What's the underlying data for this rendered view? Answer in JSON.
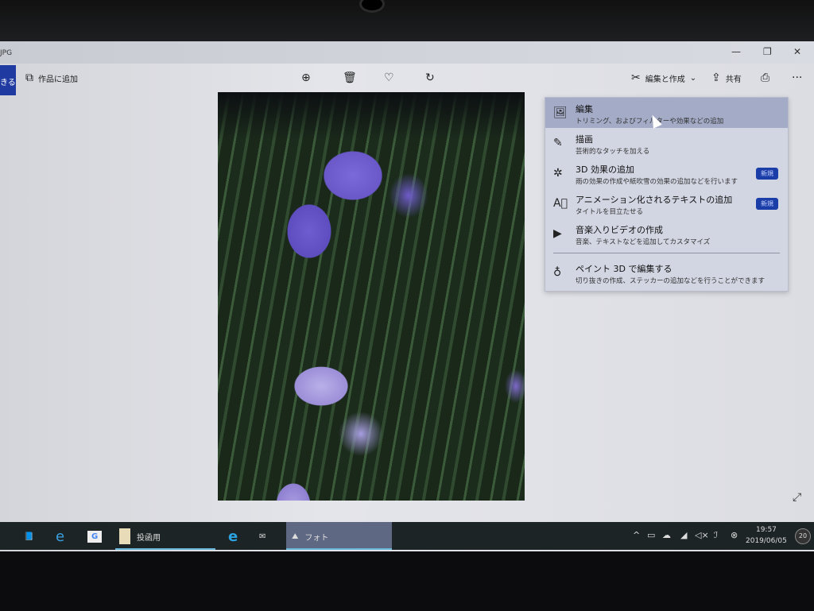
{
  "window": {
    "title": "JPG",
    "minimize": "—",
    "restore": "❐",
    "close": "✕"
  },
  "toolbar": {
    "back_label": "きる",
    "add_to_creation": "作品に追加",
    "edit_create": "編集と作成",
    "share": "共有",
    "more": "···"
  },
  "menu": {
    "items": [
      {
        "title": "編集",
        "subtitle": "トリミング、およびフィルターや効果などの追加",
        "icon": "image-edit-icon",
        "selected": true
      },
      {
        "title": "描画",
        "subtitle": "芸術的なタッチを加える",
        "icon": "pen-icon"
      },
      {
        "title": "3D 効果の追加",
        "subtitle": "雨の効果の作成や紙吹雪の効果の追加などを行います",
        "icon": "sparkle-icon",
        "badge": "新規"
      },
      {
        "title": "アニメーション化されるテキストの追加",
        "subtitle": "タイトルを目立たせる",
        "icon": "animated-text-icon",
        "badge": "新規"
      },
      {
        "title": "音楽入りビデオの作成",
        "subtitle": "音楽、テキストなどを追加してカスタマイズ",
        "icon": "video-icon"
      },
      {
        "title": "ペイント 3D で編集する",
        "subtitle": "切り抜きの作成、ステッカーの追加などを行うことができます",
        "icon": "paint3d-icon"
      }
    ]
  },
  "taskbar": {
    "folder_label": "投函用",
    "photos_label": "フォト",
    "time": "19:57",
    "date": "2019/06/05",
    "notifications": "20"
  }
}
